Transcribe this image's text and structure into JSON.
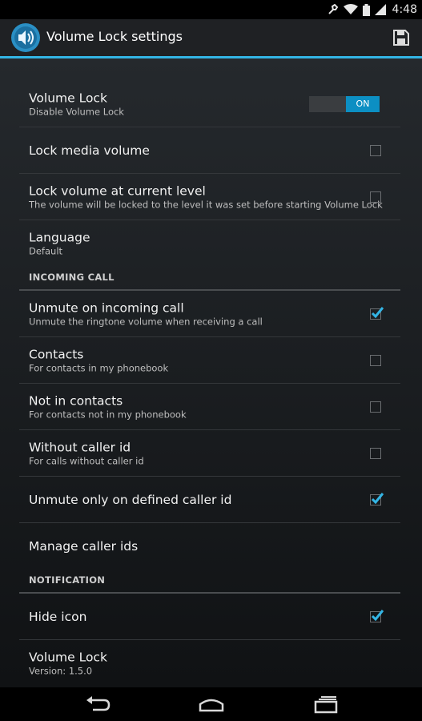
{
  "status_bar": {
    "time": "4:48",
    "icons": [
      "wrench-icon",
      "wifi-icon",
      "battery-icon",
      "signal-icon"
    ]
  },
  "action_bar": {
    "title": "Volume Lock settings",
    "app_icon": "speaker-icon",
    "save_icon": "save-icon",
    "accent_color": "#33b5e5"
  },
  "prefs": {
    "volume_lock": {
      "title": "Volume Lock",
      "summary": "Disable Volume Lock",
      "toggle_label": "ON",
      "enabled": true
    },
    "lock_media": {
      "title": "Lock media volume",
      "checked": false
    },
    "lock_current": {
      "title": "Lock volume at current level",
      "summary": "The volume will be locked to the level it was set before starting Volume Lock",
      "checked": false
    },
    "language": {
      "title": "Language",
      "summary": "Default"
    }
  },
  "incoming_call": {
    "header": "INCOMING CALL",
    "unmute": {
      "title": "Unmute on incoming call",
      "summary": "Unmute the ringtone volume when receiving a call",
      "checked": true
    },
    "contacts": {
      "title": "Contacts",
      "summary": "For contacts in my phonebook",
      "checked": false
    },
    "not_contacts": {
      "title": "Not in contacts",
      "summary": "For contacts not in my phonebook",
      "checked": false
    },
    "no_caller_id": {
      "title": "Without caller id",
      "summary": "For calls without caller id",
      "checked": false
    },
    "defined_caller": {
      "title": "Unmute only on defined caller id",
      "checked": true
    },
    "manage": {
      "title": "Manage caller ids"
    }
  },
  "notification": {
    "header": "NOTIFICATION",
    "hide_icon": {
      "title": "Hide icon",
      "checked": true
    },
    "about": {
      "title": "Volume Lock",
      "summary": "Version: 1.5.0"
    }
  },
  "nav_bar": {
    "icons": [
      "back-icon",
      "home-icon",
      "recent-apps-icon"
    ]
  }
}
